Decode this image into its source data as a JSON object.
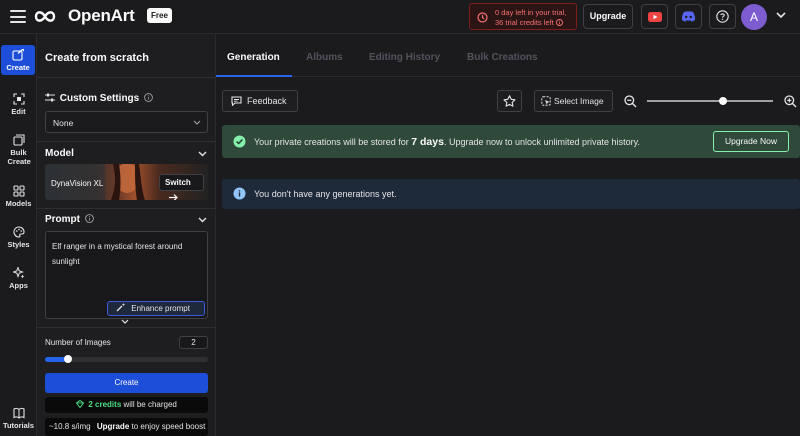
{
  "topbar": {
    "brand": "OpenArt",
    "plan_badge": "Free",
    "trial_line1": "0 day left in your trial,",
    "trial_line2": "36 trial credits left",
    "upgrade_label": "Upgrade",
    "avatar_initial": "A"
  },
  "leftnav": {
    "items": [
      {
        "label": "Create",
        "icon": "create-icon"
      },
      {
        "label": "Edit",
        "icon": "edit-icon"
      },
      {
        "label": "Bulk Create",
        "icon": "bulk-create-icon"
      },
      {
        "label": "Models",
        "icon": "models-icon"
      },
      {
        "label": "Styles",
        "icon": "styles-icon"
      },
      {
        "label": "Apps",
        "icon": "apps-icon"
      },
      {
        "label": "Tutorials",
        "icon": "tutorials-icon"
      }
    ]
  },
  "panel": {
    "title": "Create from scratch",
    "custom_settings_label": "Custom Settings",
    "settings_value": "None",
    "model_label": "Model",
    "model_name": "DynaVision XL",
    "switch_label": "Switch",
    "prompt_label": "Prompt",
    "prompt_text": "Elf ranger in a mystical forest around sunlight",
    "enhance_label": "Enhance prompt",
    "num_images_label": "Number of Images",
    "num_images_value": "2",
    "num_images_fraction": 0.14,
    "create_label": "Create",
    "credits_amount": "2 credits",
    "credits_suffix": "will be charged",
    "speed_value": "~10.8 s/img",
    "speed_upgrade": "Upgrade",
    "speed_suffix": "to enjoy speed boost"
  },
  "main": {
    "tabs": [
      "Generation",
      "Albums",
      "Editing History",
      "Bulk Creations"
    ],
    "active_tab": 0,
    "feedback_label": "Feedback",
    "select_image_label": "Select Image",
    "zoom_fraction": 0.6,
    "banner_prefix": "Your private creations will be stored for",
    "banner_days": "7 days",
    "banner_suffix": ". Upgrade now to unlock unlimited private history.",
    "upgrade_now_label": "Upgrade Now",
    "empty_message": "You don't have any generations yet."
  },
  "colors": {
    "accent": "#1d4ed8",
    "success_bg": "#2f4a3a",
    "info_bg": "#1e2a3a",
    "trial_text": "#f87171"
  }
}
